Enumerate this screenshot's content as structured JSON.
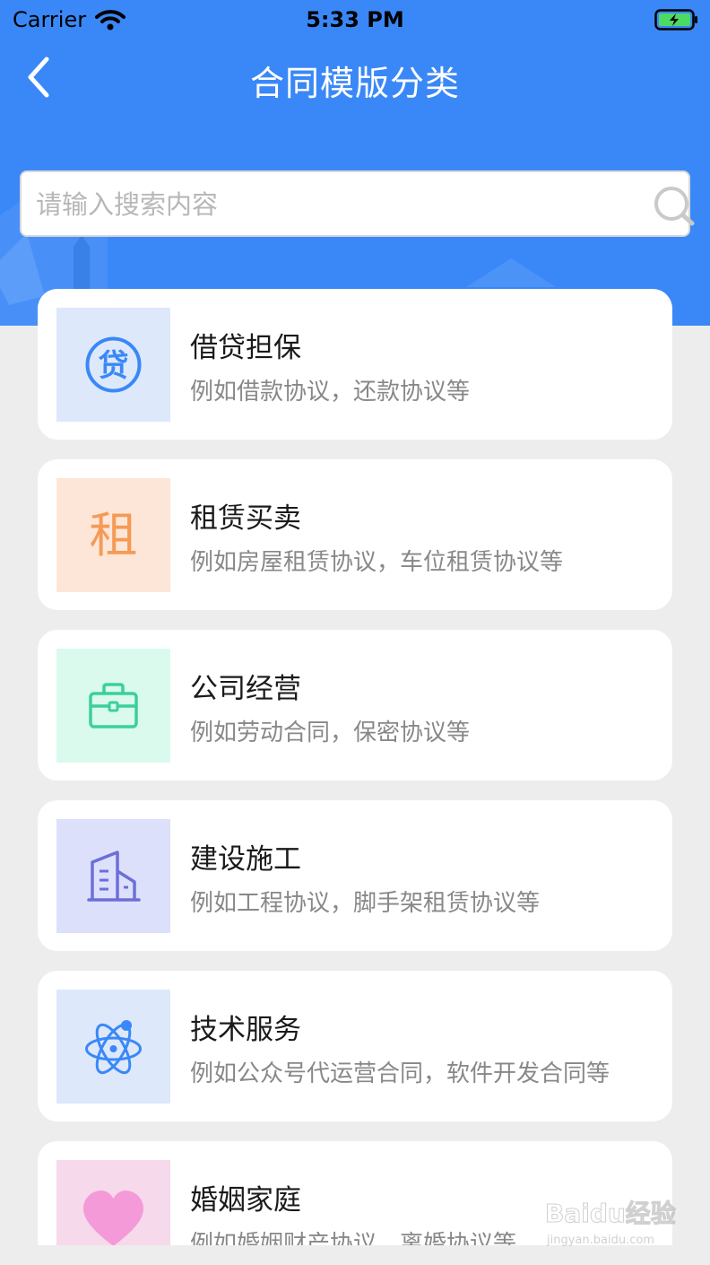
{
  "status_bar": {
    "carrier": "Carrier",
    "time": "5:33 PM"
  },
  "nav": {
    "title": "合同模版分类"
  },
  "search": {
    "placeholder": "请输入搜索内容",
    "value": ""
  },
  "categories": [
    {
      "title": "借贷担保",
      "desc": "例如借款协议，还款协议等",
      "icon": "loan-icon",
      "icon_glyph": "贷",
      "tile_color": "#dde8fb",
      "icon_color": "#3a88f7"
    },
    {
      "title": "租赁买卖",
      "desc": "例如房屋租赁协议，车位租赁协议等",
      "icon": "rent-icon",
      "icon_glyph": "租",
      "tile_color": "#fde6d8",
      "icon_color": "#f59a55"
    },
    {
      "title": "公司经营",
      "desc": "例如劳动合同，保密协议等",
      "icon": "briefcase-icon",
      "tile_color": "#d9faed",
      "icon_color": "#3ccf9a"
    },
    {
      "title": "建设施工",
      "desc": "例如工程协议，脚手架租赁协议等",
      "icon": "building-icon",
      "tile_color": "#dde0fb",
      "icon_color": "#6b6fd8"
    },
    {
      "title": "技术服务",
      "desc": "例如公众号代运营合同，软件开发合同等",
      "icon": "atom-icon",
      "tile_color": "#dde8fb",
      "icon_color": "#3a88f7"
    },
    {
      "title": "婚姻家庭",
      "desc": "例如婚姻财产协议，离婚协议等",
      "icon": "heart-icon",
      "tile_color": "#f6d9ea",
      "icon_color": "#f59ad8"
    }
  ],
  "watermark": {
    "brand": "Baidu经验",
    "url": "jingyan.baidu.com"
  },
  "colors": {
    "header": "#3a88f7",
    "background": "#ededed"
  }
}
